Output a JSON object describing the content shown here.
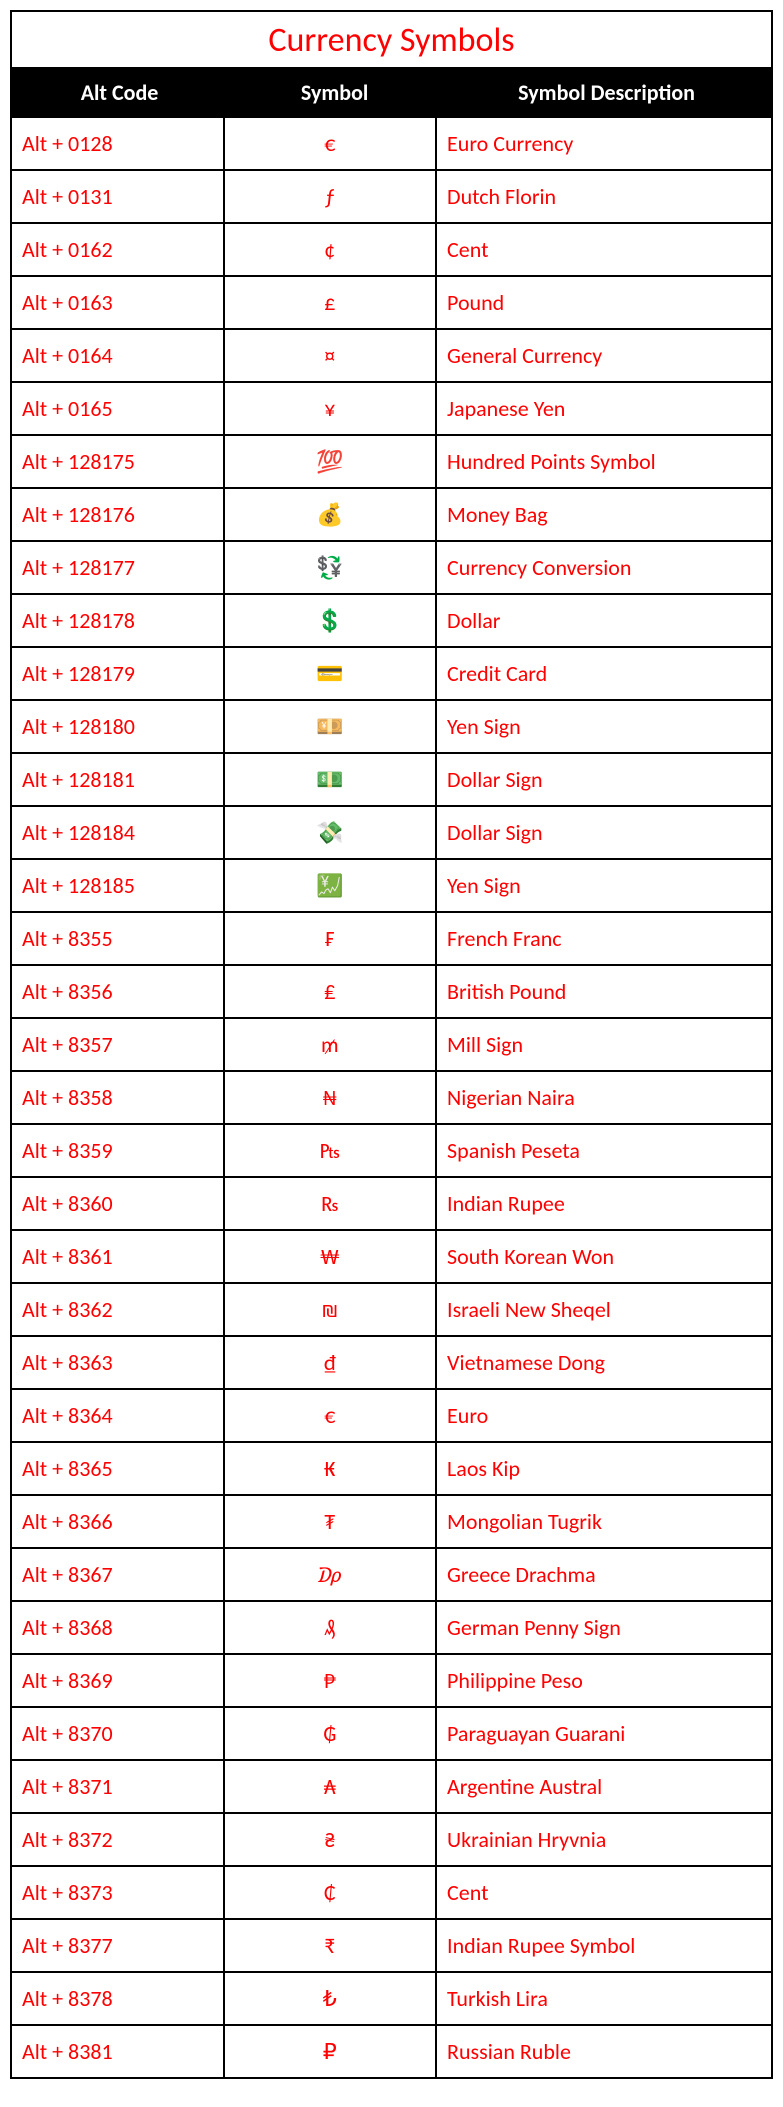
{
  "chart_data": {
    "type": "table",
    "title": "Currency Symbols",
    "columns": [
      "Alt Code",
      "Symbol",
      "Symbol Description"
    ],
    "rows": [
      {
        "code": "Alt + 0128",
        "symbol": "€",
        "desc": "Euro Currency"
      },
      {
        "code": "Alt + 0131",
        "symbol": "ƒ",
        "desc": "Dutch Florin"
      },
      {
        "code": "Alt + 0162",
        "symbol": "¢",
        "desc": "Cent"
      },
      {
        "code": "Alt + 0163",
        "symbol": "£",
        "desc": "Pound"
      },
      {
        "code": "Alt + 0164",
        "symbol": "¤",
        "desc": "General Currency"
      },
      {
        "code": "Alt + 0165",
        "symbol": "¥",
        "desc": "Japanese Yen"
      },
      {
        "code": "Alt + 128175",
        "symbol": "💯",
        "desc": "Hundred Points Symbol"
      },
      {
        "code": "Alt + 128176",
        "symbol": "💰",
        "desc": "Money Bag"
      },
      {
        "code": "Alt + 128177",
        "symbol": "💱",
        "desc": "Currency Conversion"
      },
      {
        "code": "Alt + 128178",
        "symbol": "💲",
        "desc": "Dollar"
      },
      {
        "code": "Alt + 128179",
        "symbol": "💳",
        "desc": "Credit Card"
      },
      {
        "code": "Alt + 128180",
        "symbol": "💴",
        "desc": "Yen Sign"
      },
      {
        "code": "Alt + 128181",
        "symbol": "💵",
        "desc": "Dollar Sign"
      },
      {
        "code": "Alt + 128184",
        "symbol": "💸",
        "desc": "Dollar Sign"
      },
      {
        "code": "Alt + 128185",
        "symbol": "💹",
        "desc": "Yen Sign"
      },
      {
        "code": "Alt + 8355",
        "symbol": "₣",
        "desc": "French Franc"
      },
      {
        "code": "Alt + 8356",
        "symbol": "₤",
        "desc": "British Pound"
      },
      {
        "code": "Alt + 8357",
        "symbol": "₥",
        "desc": "Mill Sign"
      },
      {
        "code": "Alt + 8358",
        "symbol": "₦",
        "desc": "Nigerian Naira"
      },
      {
        "code": "Alt + 8359",
        "symbol": "₧",
        "desc": "Spanish Peseta"
      },
      {
        "code": "Alt + 8360",
        "symbol": "₨",
        "desc": "Indian Rupee"
      },
      {
        "code": "Alt + 8361",
        "symbol": "₩",
        "desc": "South Korean Won"
      },
      {
        "code": "Alt + 8362",
        "symbol": "₪",
        "desc": "Israeli New Sheqel"
      },
      {
        "code": "Alt + 8363",
        "symbol": "₫",
        "desc": "Vietnamese Dong"
      },
      {
        "code": "Alt + 8364",
        "symbol": "€",
        "desc": "Euro"
      },
      {
        "code": "Alt + 8365",
        "symbol": "₭",
        "desc": "Laos Kip"
      },
      {
        "code": "Alt + 8366",
        "symbol": "₮",
        "desc": "Mongolian Tugrik"
      },
      {
        "code": "Alt + 8367",
        "symbol": "₯",
        "desc": "Greece Drachma"
      },
      {
        "code": "Alt + 8368",
        "symbol": "₰",
        "desc": "German Penny  Sign"
      },
      {
        "code": "Alt + 8369",
        "symbol": "₱",
        "desc": "Philippine Peso"
      },
      {
        "code": "Alt + 8370",
        "symbol": "₲",
        "desc": "Paraguayan Guarani"
      },
      {
        "code": "Alt + 8371",
        "symbol": "₳",
        "desc": "Argentine Austral"
      },
      {
        "code": "Alt + 8372",
        "symbol": "₴",
        "desc": "Ukrainian Hryvnia"
      },
      {
        "code": "Alt + 8373",
        "symbol": "₵",
        "desc": "Cent"
      },
      {
        "code": "Alt + 8377",
        "symbol": "₹",
        "desc": "Indian Rupee Symbol"
      },
      {
        "code": "Alt + 8378",
        "symbol": "₺",
        "desc": "Turkish Lira"
      },
      {
        "code": "Alt + 8381",
        "symbol": "₽",
        "desc": "Russian Ruble"
      }
    ]
  }
}
